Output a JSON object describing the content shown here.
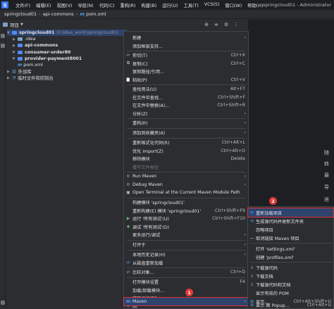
{
  "titlebar": {
    "logo": "IJ",
    "menus": [
      "文件(F)",
      "编辑(E)",
      "视图(V)",
      "导航(N)",
      "代码(C)",
      "重构(R)",
      "构建(B)",
      "运行(U)",
      "工具(T)",
      "VCS(S)",
      "窗口(W)",
      "帮助(H)"
    ],
    "window_title": "springcloud01 - Administrator"
  },
  "breadcrumb": {
    "items": [
      "springcloud01",
      "api-commons"
    ],
    "file_icon": "m",
    "file": "pom.xml"
  },
  "project_toolbar": {
    "label": "项目",
    "buttons": [
      "⊕",
      "≑",
      "✕",
      "⋮"
    ]
  },
  "tree": {
    "root_name": "springcloud01",
    "root_path": "D:\\idea_work\\springcloud01",
    "children": [
      ".idea",
      "api-commons",
      "consumer-order80",
      "provider-payment8001"
    ],
    "pom_icon": "m",
    "pom": "pom.xml",
    "ext_libs": "外部库",
    "scratch": "临时文件和控制台"
  },
  "context_menu": {
    "items": [
      {
        "label": "新建",
        "shortcut": "",
        "sub": "›"
      },
      {
        "label": "添加框架支持...",
        "shortcut": ""
      },
      {
        "label": "剪切(T)",
        "shortcut": "Ctrl+X"
      },
      {
        "label": "复制(C)",
        "shortcut": "Ctrl+C"
      },
      {
        "label": "复制路径/引用...",
        "shortcut": ""
      },
      {
        "label": "粘贴(P)",
        "shortcut": "Ctrl+V"
      },
      {
        "label": "查找用法(U)",
        "shortcut": "Alt+F7"
      },
      {
        "label": "在文件中查找...",
        "shortcut": "Ctrl+Shift+F"
      },
      {
        "label": "在文件中替换(A)...",
        "shortcut": "Ctrl+Shift+R"
      },
      {
        "label": "分析(Z)",
        "shortcut": "",
        "sub": "›"
      },
      {
        "label": "重构(R)",
        "shortcut": "",
        "sub": "›"
      },
      {
        "label": "添加到收藏夹(A)",
        "shortcut": "",
        "sub": "›"
      },
      {
        "label": "重新格式化代码(R)",
        "shortcut": "Ctrl+Alt+L"
      },
      {
        "label": "优化 import(Z)",
        "shortcut": "Ctrl+Alt+O"
      },
      {
        "label": "移除模块",
        "shortcut": "Delete"
      },
      {
        "label": "覆写文件类型",
        "shortcut": ""
      },
      {
        "label": "Run Maven",
        "shortcut": "",
        "sub": "›"
      },
      {
        "label": "Debug Maven",
        "shortcut": "",
        "sub": "›"
      },
      {
        "label": "Open Terminal at the Current Maven Module Path",
        "shortcut": ""
      },
      {
        "label": "构建模块 'springcloud01'",
        "shortcut": ""
      },
      {
        "label": "重新构建(E) 模块 'springcloud01'",
        "shortcut": "Ctrl+Shift+F9"
      },
      {
        "label": "运行 '所有测试'(U)",
        "shortcut": "Ctrl+Shift+F10"
      },
      {
        "label": "调试 '所有测试'(D)",
        "shortcut": ""
      },
      {
        "label": "更多运行/调试",
        "shortcut": "",
        "sub": "›"
      },
      {
        "label": "打开于",
        "shortcut": "",
        "sub": "›"
      },
      {
        "label": "本地历史记录(H)",
        "shortcut": "",
        "sub": "›"
      },
      {
        "label": "从磁盘重新加载",
        "shortcut": ""
      },
      {
        "label": "比较对象...",
        "shortcut": "Ctrl+D"
      },
      {
        "label": "打开模块设置",
        "shortcut": "F4"
      },
      {
        "label": "加载/卸载模块...",
        "shortcut": ""
      },
      {
        "label": "将目录标记为",
        "shortcut": "",
        "sub": "›"
      },
      {
        "label": "图",
        "shortcut": "",
        "sub": "›"
      },
      {
        "label": "Maven",
        "shortcut": "",
        "sub": "›"
      }
    ]
  },
  "maven_submenu": {
    "items": [
      {
        "label": "重新加载项目",
        "shortcut": ""
      },
      {
        "label": "生成源代码并更新文件夹",
        "shortcut": ""
      },
      {
        "label": "忽略项目",
        "shortcut": ""
      },
      {
        "label": "取消链接 Maven 项目",
        "shortcut": ""
      },
      {
        "label": "打开 'settings.xml'",
        "shortcut": ""
      },
      {
        "label": "创建 'profiles.xml'",
        "shortcut": ""
      },
      {
        "label": "下载源代码",
        "shortcut": ""
      },
      {
        "label": "下载文档",
        "shortcut": ""
      },
      {
        "label": "下载源代码和文档",
        "shortcut": ""
      },
      {
        "label": "显示有效的 POM",
        "shortcut": ""
      },
      {
        "label": "显示...",
        "shortcut": "Ctrl+Alt+Shift+U"
      },
      {
        "label": "显示 图 Popup...",
        "shortcut": "Ctrl+Alt+U"
      }
    ]
  },
  "editor_tips": [
    "随",
    "转",
    "最",
    "导",
    "将"
  ],
  "badges": {
    "one": "1",
    "two": "2"
  },
  "colors": {
    "accent": "#3574f0",
    "selection": "#2e436e",
    "badge": "#e03a3a"
  }
}
